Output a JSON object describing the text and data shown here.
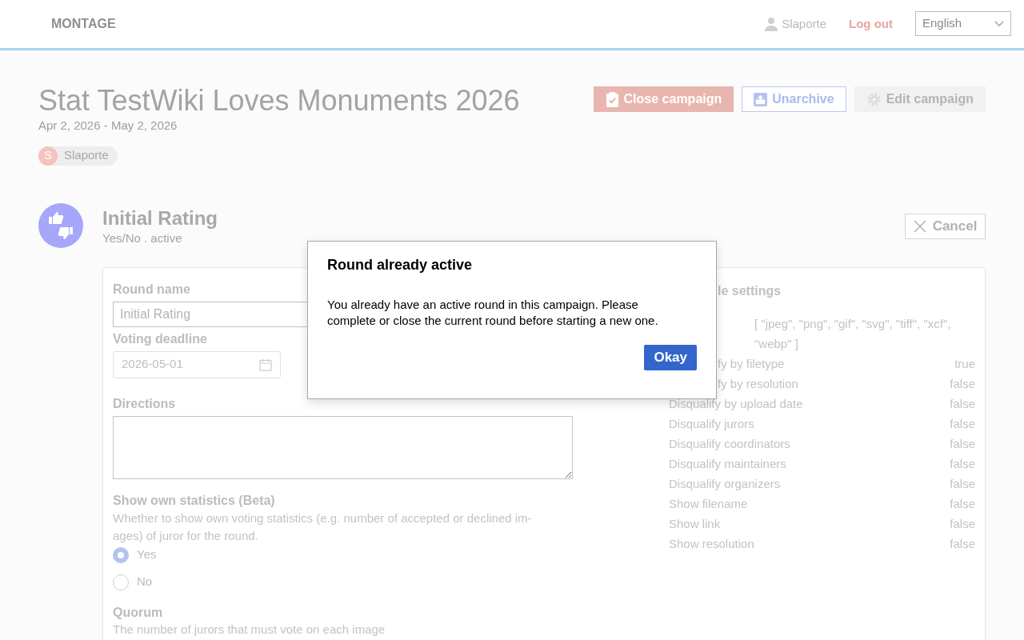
{
  "header": {
    "brand": "MONTAGE",
    "user": "Slaporte",
    "logout": "Log out",
    "language": "English"
  },
  "campaign": {
    "title": "Stat TestWiki Loves Monuments 2026",
    "dates": "Apr 2, 2026 - May 2, 2026",
    "coordinators": [
      {
        "initial": "S",
        "name": "Slaporte"
      }
    ],
    "actions": [
      {
        "label": "Close campaign",
        "kind": "danger"
      },
      {
        "label": "Unarchive",
        "kind": "outline"
      },
      {
        "label": "Edit campaign",
        "kind": "disabled"
      }
    ]
  },
  "round": {
    "name": "Initial Rating",
    "subtitle": "Yes/No . active",
    "cancel": "Cancel",
    "form": {
      "round_name_label": "Round name",
      "round_name_value": "Initial Rating",
      "deadline_label": "Voting deadline",
      "deadline_value": "2026-05-01",
      "directions_label": "Directions",
      "stats_label": "Show own statistics (Beta)",
      "stats_description": "Whether to show own voting statistics (e.g. number of accepted or declined im-ages) of juror for the round.",
      "options": [
        {
          "label": "Yes",
          "selected": true
        },
        {
          "label": "No",
          "selected": false
        }
      ],
      "quorum_label": "Quorum",
      "quorum_description": "The number of jurors that must vote on each image"
    },
    "settings": {
      "title": "le settings",
      "file_types_value": "[ \"jpeg\", \"png\", \"gif\", \"svg\", \"tiff\", \"xcf\", \"webp\" ]",
      "partly_hidden_rows": [
        {
          "label": "fy by filetype",
          "value": "true"
        },
        {
          "label": "fy by resolution",
          "value": "false"
        }
      ],
      "rows": [
        {
          "label": "Disqualify by upload date",
          "value": "false"
        },
        {
          "label": "Disqualify jurors",
          "value": "false"
        },
        {
          "label": "Disqualify coordinators",
          "value": "false"
        },
        {
          "label": "Disqualify maintainers",
          "value": "false"
        },
        {
          "label": "Disqualify organizers",
          "value": "false"
        },
        {
          "label": "Show filename",
          "value": "false"
        },
        {
          "label": "Show link",
          "value": "false"
        },
        {
          "label": "Show resolution",
          "value": "false"
        }
      ]
    }
  },
  "dialog": {
    "title": "Round already active",
    "message": "You already have an active round in this campaign. Please complete or close the current round before starting a new one.",
    "button": "Okay"
  }
}
